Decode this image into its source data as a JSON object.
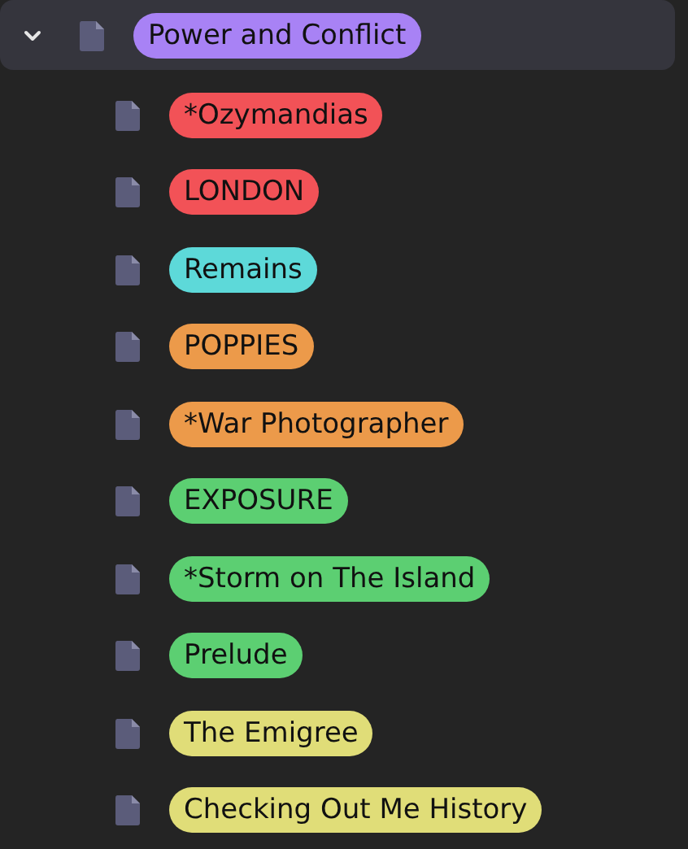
{
  "tree": {
    "label": "Power and Conflict",
    "color": "#a882f5",
    "expanded": true,
    "selected": true,
    "children": [
      {
        "label": "*Ozymandias",
        "color": "#f25257",
        "selected": false
      },
      {
        "label": "LONDON",
        "color": "#f25257",
        "selected": false
      },
      {
        "label": "Remains",
        "color": "#5dd9d9",
        "selected": false
      },
      {
        "label": "POPPIES",
        "color": "#ec9a4a",
        "selected": false
      },
      {
        "label": "*War Photographer",
        "color": "#ec9a4a",
        "selected": false
      },
      {
        "label": "EXPOSURE",
        "color": "#5ccf72",
        "selected": false
      },
      {
        "label": "*Storm on The Island",
        "color": "#5ccf72",
        "selected": false
      },
      {
        "label": "Prelude",
        "color": "#5ccf72",
        "selected": false
      },
      {
        "label": "The Emigree",
        "color": "#e0dd78",
        "selected": false
      },
      {
        "label": "Checking Out Me History",
        "color": "#e0dd78",
        "selected": false
      }
    ]
  }
}
